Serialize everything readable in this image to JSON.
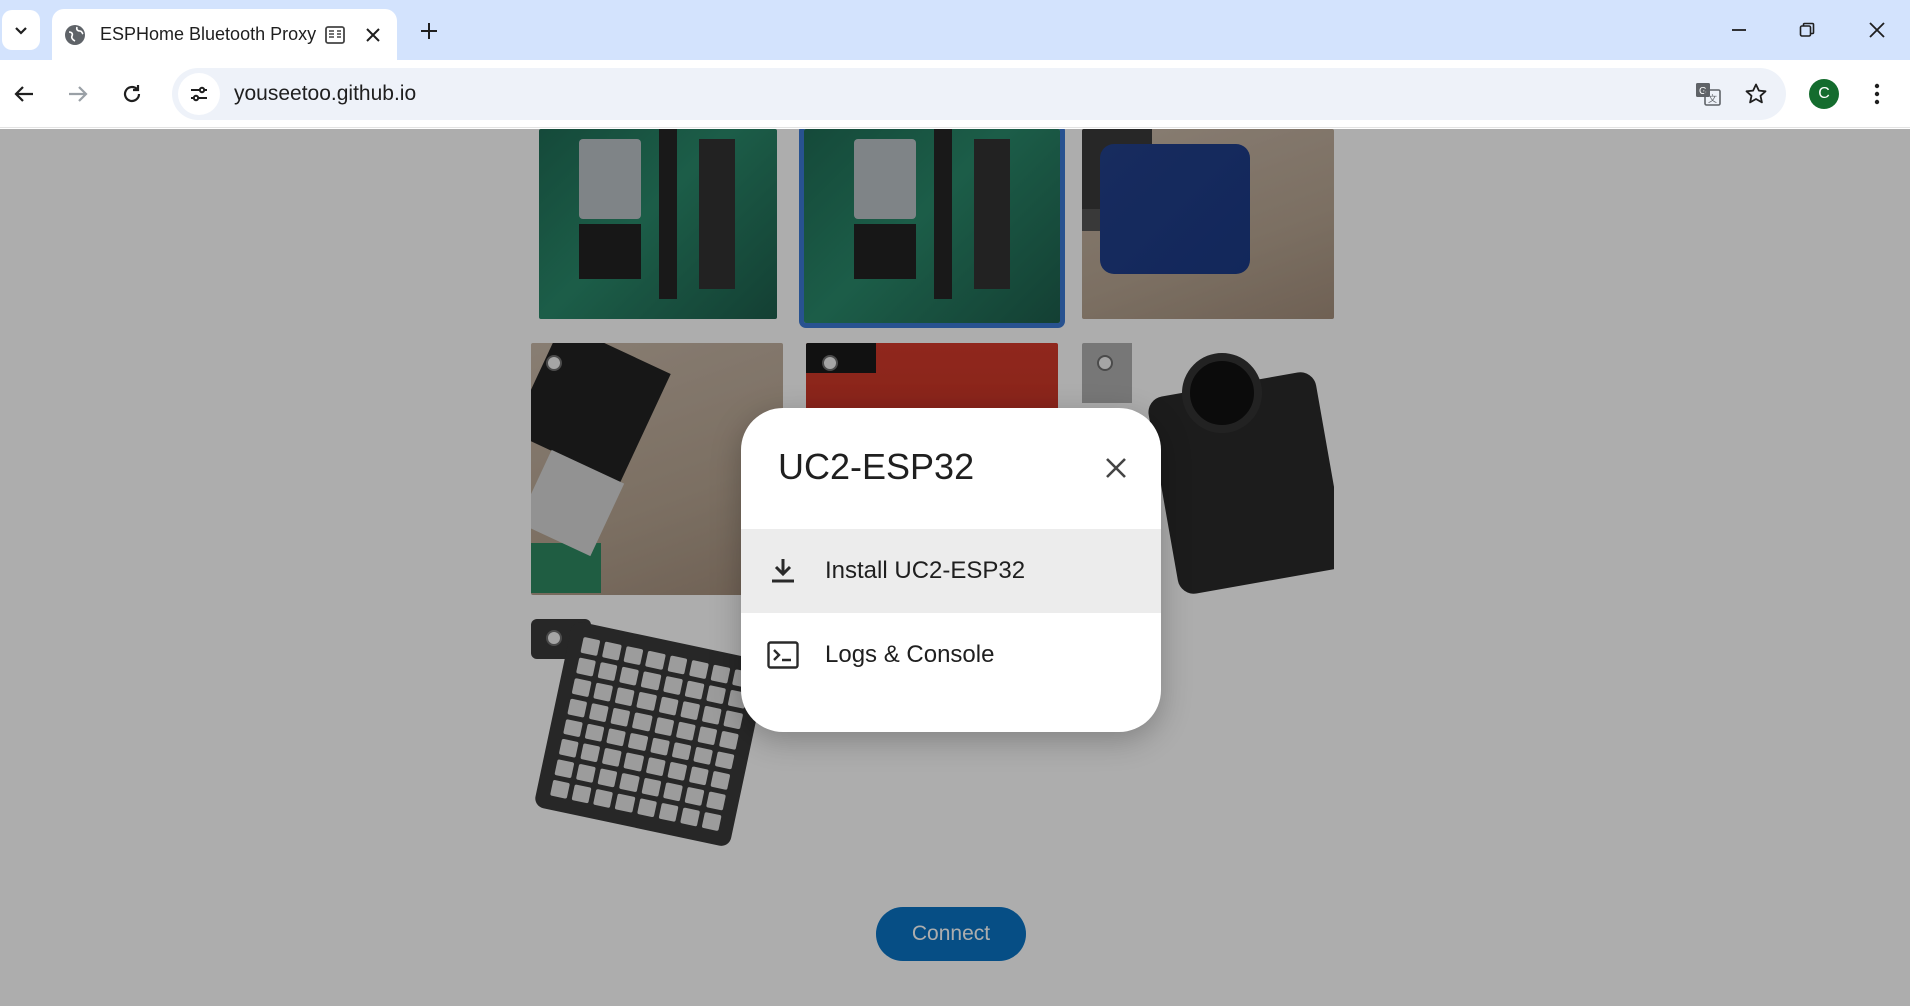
{
  "browser": {
    "tab_title": "ESPHome Bluetooth Proxy",
    "url": "youseetoo.github.io",
    "profile_initial": "C"
  },
  "page": {
    "connect_label": "Connect"
  },
  "dialog": {
    "title": "UC2-ESP32",
    "items": [
      {
        "label": "Install UC2-ESP32",
        "icon": "download-icon"
      },
      {
        "label": "Logs & Console",
        "icon": "terminal-icon"
      }
    ]
  },
  "colors": {
    "tabstrip": "#d3e3fd",
    "omnibox": "#eef2f9",
    "connect_button": "#0a74c4",
    "selected_outline": "#3c79d4",
    "avatar": "#146c2e"
  }
}
